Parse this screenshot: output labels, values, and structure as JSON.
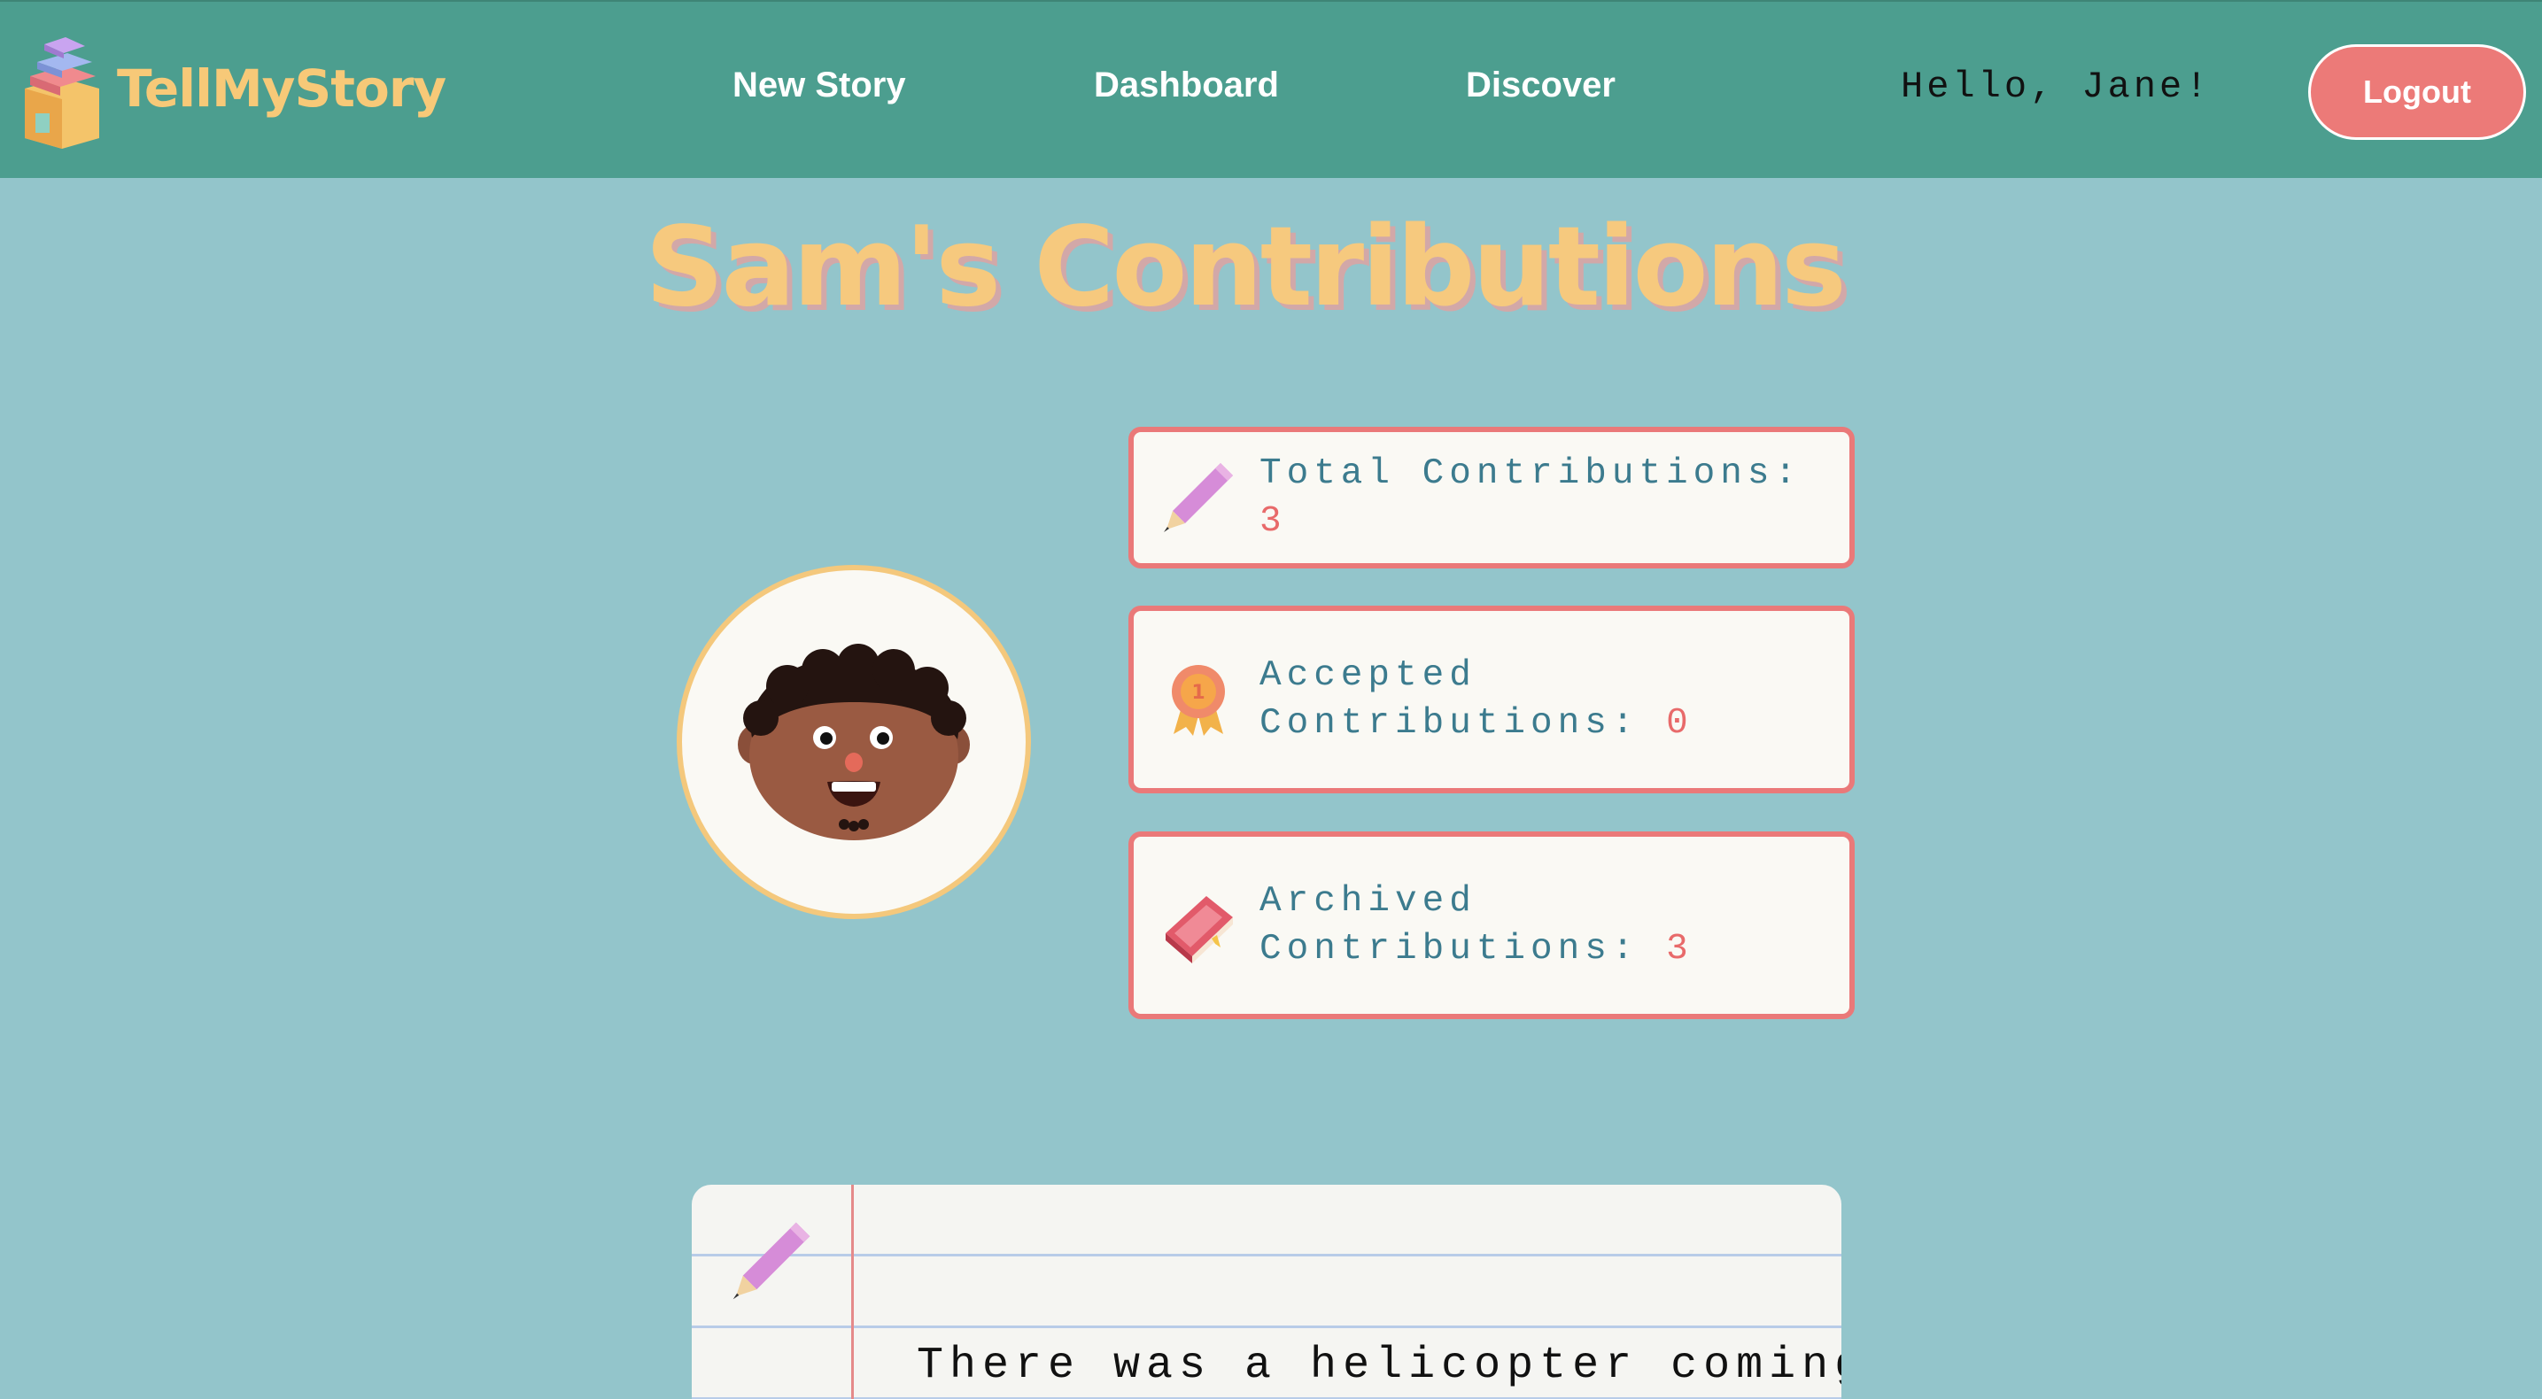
{
  "navbar": {
    "brand": "TellMyStory",
    "links": {
      "new_story": "New Story",
      "dashboard": "Dashboard",
      "discover": "Discover"
    },
    "greeting": "Hello, Jane!",
    "logout_label": "Logout"
  },
  "title": "Sam's Contributions",
  "stats": {
    "total": {
      "label": "Total Contributions:",
      "value": "3",
      "icon": "pencil-icon"
    },
    "accepted": {
      "label_line1": "Accepted",
      "label_line2": "Contributions:",
      "value": "0",
      "icon": "award-ribbon-icon"
    },
    "archived": {
      "label_line1": "Archived",
      "label_line2": "Contributions:",
      "value": "3",
      "icon": "book-icon"
    }
  },
  "story": {
    "text": "There was a helicopter coming",
    "icon": "pencil-icon"
  },
  "colors": {
    "background": "#93c5cb",
    "navbar": "#4c9e8f",
    "brand": "#f7c978",
    "title": "#f6c97e",
    "accent": "#ea7979",
    "stat_text": "#3c7b8e"
  }
}
